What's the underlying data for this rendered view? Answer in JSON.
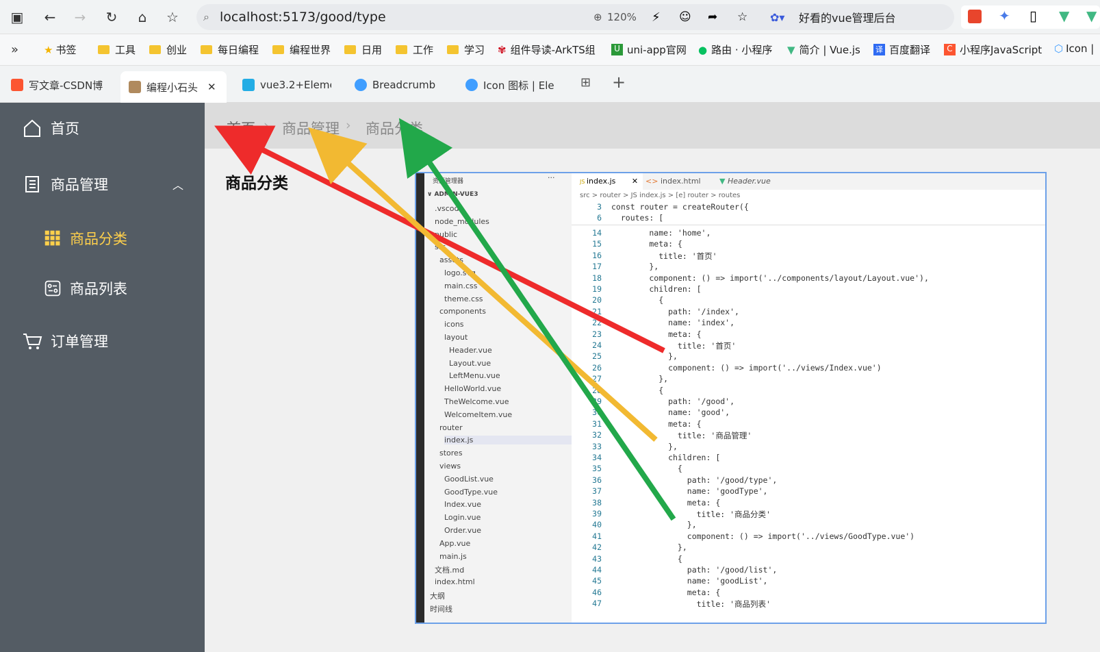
{
  "browser": {
    "url": "localhost:5173/good/type",
    "zoom": "120%",
    "extension_label": "好看的vue管理后台"
  },
  "bookmarks": [
    {
      "label": "书签",
      "icon": "star-icon"
    },
    {
      "label": "工具",
      "icon": "folder-icon"
    },
    {
      "label": "创业",
      "icon": "folder-icon"
    },
    {
      "label": "每日编程",
      "icon": "folder-icon"
    },
    {
      "label": "编程世界",
      "icon": "folder-icon"
    },
    {
      "label": "日用",
      "icon": "folder-icon"
    },
    {
      "label": "工作",
      "icon": "folder-icon"
    },
    {
      "label": "学习",
      "icon": "folder-icon"
    },
    {
      "label": "组件导读-ArkTS组",
      "icon": "huawei-icon"
    },
    {
      "label": "uni-app官网",
      "icon": "uniapp-icon"
    },
    {
      "label": "路由 · 小程序",
      "icon": "wechat-icon"
    },
    {
      "label": "简介 | Vue.js",
      "icon": "vue-icon"
    },
    {
      "label": "百度翻译",
      "icon": "translate-icon"
    },
    {
      "label": "小程序JavaScript",
      "icon": "csdn-icon"
    },
    {
      "label": "Icon |",
      "icon": "element-icon"
    }
  ],
  "tabs": [
    {
      "label": "写文章-CSDN博",
      "active": false
    },
    {
      "label": "编程小石头",
      "active": true
    },
    {
      "label": "vue3.2+Eleme",
      "active": false
    },
    {
      "label": "Breadcrumb",
      "active": false
    },
    {
      "label": "Icon 图标 | Ele",
      "active": false
    }
  ],
  "sidebar": {
    "items": [
      {
        "label": "首页",
        "icon": "home-icon"
      },
      {
        "label": "商品管理",
        "icon": "document-icon"
      },
      {
        "label": "商品分类",
        "icon": "grid-icon",
        "active": true
      },
      {
        "label": "商品列表",
        "icon": "list-icon"
      },
      {
        "label": "订单管理",
        "icon": "cart-icon"
      }
    ]
  },
  "breadcrumb": [
    "首页",
    "商品管理",
    "商品分类"
  ],
  "page_title": "商品分类",
  "editor": {
    "explorer_header": "资源管理器",
    "explorer_project": "ADMIN-VUE3",
    "tabs": [
      "index.js",
      "index.html",
      "Header.vue"
    ],
    "path": "src > router > JS index.js > [e] router > routes",
    "files": [
      ".vscode",
      "node_modules",
      "public",
      "src",
      "assets",
      "logo.svg",
      "main.css",
      "theme.css",
      "components",
      "icons",
      "layout",
      "Header.vue",
      "Layout.vue",
      "LeftMenu.vue",
      "HelloWorld.vue",
      "TheWelcome.vue",
      "WelcomeItem.vue",
      "router",
      "index.js",
      "stores",
      "views",
      "GoodList.vue",
      "GoodType.vue",
      "Index.vue",
      "Login.vue",
      "Order.vue",
      "App.vue",
      "main.js",
      "文档.md",
      "index.html",
      "大纲",
      "时间线"
    ],
    "sticky_lines": [
      {
        "n": "3",
        "t": "const router = createRouter({"
      },
      {
        "n": "6",
        "t": "  routes: ["
      }
    ],
    "lines": [
      {
        "n": "14",
        "t": "        name: 'home',"
      },
      {
        "n": "15",
        "t": "        meta: {"
      },
      {
        "n": "16",
        "t": "          title: '首页'"
      },
      {
        "n": "17",
        "t": "        },"
      },
      {
        "n": "18",
        "t": "        component: () => import('../components/layout/Layout.vue'),"
      },
      {
        "n": "19",
        "t": "        children: ["
      },
      {
        "n": "20",
        "t": "          {"
      },
      {
        "n": "21",
        "t": "            path: '/index',"
      },
      {
        "n": "22",
        "t": "            name: 'index',"
      },
      {
        "n": "23",
        "t": "            meta: {"
      },
      {
        "n": "24",
        "t": "              title: '首页'"
      },
      {
        "n": "25",
        "t": "            },"
      },
      {
        "n": "26",
        "t": "            component: () => import('../views/Index.vue')"
      },
      {
        "n": "27",
        "t": "          },"
      },
      {
        "n": "28",
        "t": "          {"
      },
      {
        "n": "29",
        "t": "            path: '/good',"
      },
      {
        "n": "30",
        "t": "            name: 'good',"
      },
      {
        "n": "31",
        "t": "            meta: {"
      },
      {
        "n": "32",
        "t": "              title: '商品管理'"
      },
      {
        "n": "33",
        "t": "            },"
      },
      {
        "n": "34",
        "t": "            children: ["
      },
      {
        "n": "35",
        "t": "              {"
      },
      {
        "n": "36",
        "t": "                path: '/good/type',"
      },
      {
        "n": "37",
        "t": "                name: 'goodType',"
      },
      {
        "n": "38",
        "t": "                meta: {"
      },
      {
        "n": "39",
        "t": "                  title: '商品分类'"
      },
      {
        "n": "40",
        "t": "                },"
      },
      {
        "n": "41",
        "t": "                component: () => import('../views/GoodType.vue')"
      },
      {
        "n": "42",
        "t": "              },"
      },
      {
        "n": "43",
        "t": "              {"
      },
      {
        "n": "44",
        "t": "                path: '/good/list',"
      },
      {
        "n": "45",
        "t": "                name: 'goodList',"
      },
      {
        "n": "46",
        "t": "                meta: {"
      },
      {
        "n": "47",
        "t": "                  title: '商品列表'"
      }
    ]
  },
  "colors": {
    "sidebar_bg": "#545c64",
    "active_menu": "#ffd04b",
    "arrow_red": "#ee2b2b",
    "arrow_yellow": "#f2b932",
    "arrow_green": "#22a84a"
  }
}
